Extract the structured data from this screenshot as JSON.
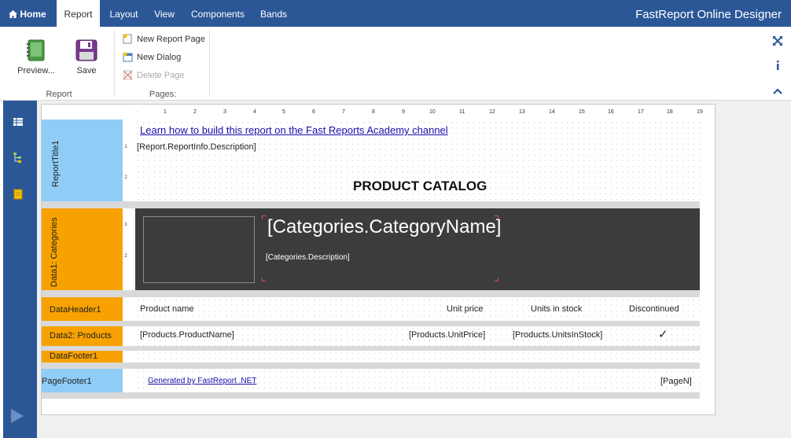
{
  "topbar": {
    "tabs": [
      {
        "label": "Home",
        "icon": "home-icon"
      },
      {
        "label": "Report"
      },
      {
        "label": "Layout"
      },
      {
        "label": "View"
      },
      {
        "label": "Components"
      },
      {
        "label": "Bands"
      }
    ],
    "active_tab": "Report",
    "app_title": "FastReport Online Designer",
    "bg_color": "#2b5797"
  },
  "ribbon": {
    "report_group": {
      "preview_label": "Preview...",
      "save_label": "Save",
      "group_label": "Report"
    },
    "pages_group": {
      "new_page_label": "New Report Page",
      "new_dialog_label": "New Dialog",
      "delete_page_label": "Delete Page",
      "group_label": "Pages:"
    }
  },
  "ruler": {
    "numbers": [
      "1",
      "2",
      "3",
      "4",
      "5",
      "6",
      "7",
      "8",
      "9",
      "10",
      "11",
      "12",
      "13",
      "14",
      "15",
      "16",
      "17",
      "18",
      "19"
    ]
  },
  "bands": {
    "report_title": {
      "label": "ReportTitle1",
      "link_text": "Learn how to build this report on the Fast Reports Academy channel",
      "description": "[Report.ReportInfo.Description]",
      "heading": "PRODUCT CATALOG",
      "ruler_numbers": [
        "1",
        "2"
      ]
    },
    "data1": {
      "label": "Data1: Categories",
      "category_name": "[Categories.CategoryName]",
      "category_desc": "[Categories.Description]",
      "ruler_numbers": [
        "1",
        "2"
      ],
      "bg_color": "#3c3c3c"
    },
    "data_header": {
      "label": "DataHeader1",
      "columns": [
        "Product name",
        "Unit price",
        "Units in stock",
        "Discontinued"
      ]
    },
    "data2": {
      "label": "Data2: Products",
      "fields": [
        "[Products.ProductName]",
        "[Products.UnitPrice]",
        "[Products.UnitsInStock]"
      ],
      "check_mark": "✓"
    },
    "data_footer": {
      "label": "DataFooter1"
    },
    "page_footer": {
      "label": "PageFooter1",
      "generated_text": "Generated by FastReport .NET",
      "page_number": "[PageN]"
    }
  },
  "colors": {
    "band_blue": "#8fcdf7",
    "band_orange": "#f7a200",
    "link": "#1a0dab"
  }
}
